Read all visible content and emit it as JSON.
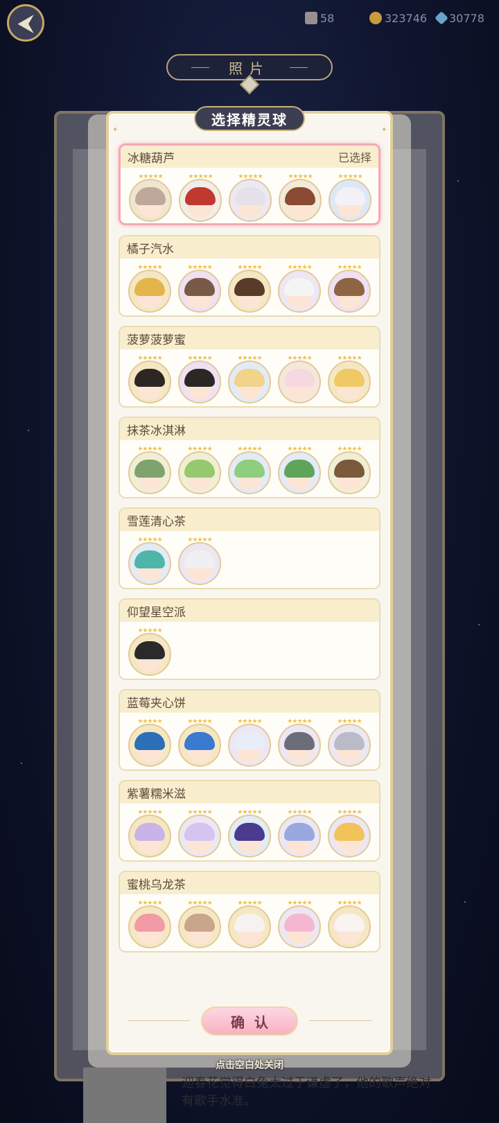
{
  "topbar": {
    "back_glyph": "⮜",
    "books": "58",
    "coins": "323746",
    "gems": "30778"
  },
  "background_title": "照片",
  "background_text": "迎春花觉得白兔太过于谦虚了，他的歌声绝对有歌手水准。",
  "dialog": {
    "title": "选择精灵球",
    "confirm_label": "确认",
    "close_tip": "点击空白处关闭"
  },
  "groups": [
    {
      "name": "冰糖葫芦",
      "status": "已选择",
      "count": 5
    },
    {
      "name": "橘子汽水",
      "status": "",
      "count": 5
    },
    {
      "name": "菠萝菠萝蜜",
      "status": "",
      "count": 5
    },
    {
      "name": "抹茶冰淇淋",
      "status": "",
      "count": 5
    },
    {
      "name": "雪莲清心茶",
      "status": "",
      "count": 2
    },
    {
      "name": "仰望星空派",
      "status": "",
      "count": 1
    },
    {
      "name": "蓝莓夹心饼",
      "status": "",
      "count": 5
    },
    {
      "name": "紫薯糯米滋",
      "status": "",
      "count": 5
    },
    {
      "name": "蜜桃乌龙茶",
      "status": "",
      "count": 5
    }
  ],
  "colors": {
    "accent_gold": "#e2cf9b",
    "selected_border": "#f6a7b7",
    "confirm_pink": "#f7b2c3"
  }
}
